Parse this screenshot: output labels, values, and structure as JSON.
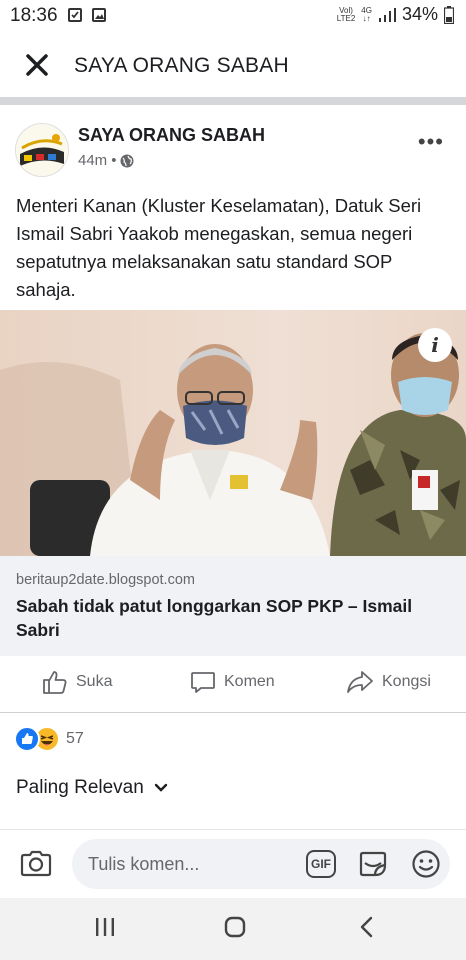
{
  "status_bar": {
    "time": "18:36",
    "network_top": "Vol)",
    "network_bottom": "LTE2",
    "network_type": "4G",
    "battery": "34%"
  },
  "app_bar": {
    "close_icon": "close-icon",
    "title": "SAYA ORANG SABAH"
  },
  "post": {
    "page_name": "SAYA ORANG SABAH",
    "time": "44m",
    "separator": "•",
    "audience_icon": "globe-icon",
    "more_label": "•••",
    "text": "Menteri Kanan (Kluster Keselamatan), Datuk Seri Ismail Sabri Yaakob menegaskan, semua negeri sepatutnya melaksanakan satu standard SOP sahaja.",
    "info_label": "i",
    "link": {
      "domain": "beritaup2date.blogspot.com",
      "title": "Sabah tidak patut longgarkan SOP PKP – Ismail Sabri"
    }
  },
  "actions": {
    "like": "Suka",
    "comment": "Komen",
    "share": "Kongsi"
  },
  "reactions": {
    "count": "57",
    "types": [
      "like-icon",
      "haha-icon"
    ]
  },
  "comments": {
    "sort_label": "Paling Relevan"
  },
  "composer": {
    "placeholder": "Tulis komen...",
    "gif_label": "GIF"
  },
  "colors": {
    "primary_text": "#1c1e21",
    "secondary_text": "#65676b",
    "link_bg": "#f0f2f5",
    "like_blue": "#1877f2",
    "haha_yellow": "#f7b928"
  }
}
